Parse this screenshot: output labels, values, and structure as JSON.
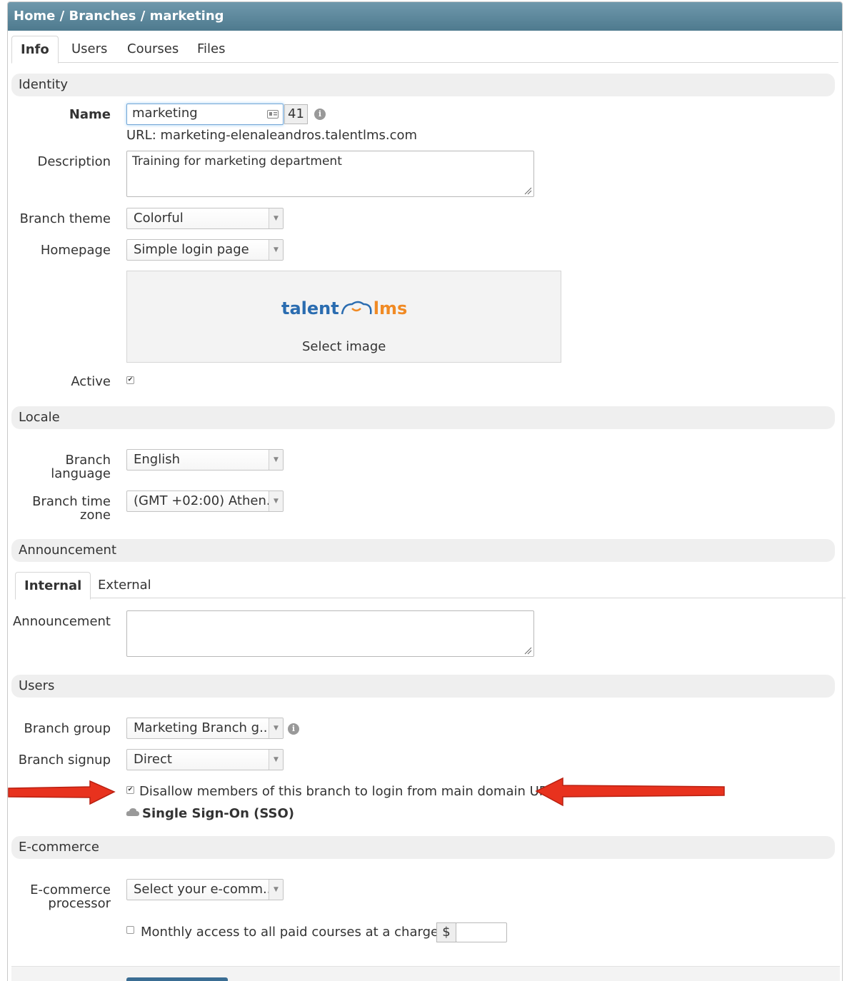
{
  "breadcrumb": {
    "home": "Home",
    "sep1": " / ",
    "branches": "Branches",
    "sep2": " / ",
    "current": "marketing"
  },
  "tabs": [
    "Info",
    "Users",
    "Courses",
    "Files"
  ],
  "identity": {
    "section_title": "Identity",
    "name_label": "Name",
    "name_value": "marketing",
    "name_count": "41",
    "url_text": "URL: marketing-elenaleandros.talentlms.com",
    "description_label": "Description",
    "description_value": "Training for marketing department",
    "theme_label": "Branch theme",
    "theme_value": "Colorful",
    "homepage_label": "Homepage",
    "homepage_value": "Simple login page",
    "logo_left": "talent",
    "logo_right": "lms",
    "select_image": "Select image",
    "active_label": "Active",
    "active_checked": true
  },
  "locale": {
    "section_title": "Locale",
    "language_label_1": "Branch",
    "language_label_2": "language",
    "language_value": "English",
    "timezone_label_1": "Branch time",
    "timezone_label_2": "zone",
    "timezone_value": "(GMT +02:00) Athen..."
  },
  "announcement": {
    "section_title": "Announcement",
    "tabs": [
      "Internal",
      "External"
    ],
    "field_label": "Announcement",
    "field_value": ""
  },
  "users": {
    "section_title": "Users",
    "group_label": "Branch group",
    "group_value": "Marketing Branch g...",
    "signup_label": "Branch signup",
    "signup_value": "Direct",
    "disallow_text": "Disallow members of this branch to login from main domain URL",
    "disallow_checked": true,
    "sso_text": "Single Sign-On (SSO)"
  },
  "ecommerce": {
    "section_title": "E-commerce",
    "processor_label_1": "E-commerce",
    "processor_label_2": "processor",
    "processor_value": "Select your e-comm...",
    "monthly_text": "Monthly access to all paid courses at a charge of",
    "monthly_checked": false,
    "currency": "$",
    "charge_value": ""
  },
  "colors": {
    "header": "#5b889c",
    "arrow": "#e8321e",
    "section_bg": "#efefef",
    "focus": "#76a7d6"
  },
  "icons": {
    "info": "info-icon",
    "name_card": "id-card-icon",
    "cloud": "cloud-icon",
    "arrow_left": "red-arrow-icon",
    "arrow_right": "red-arrow-icon"
  }
}
